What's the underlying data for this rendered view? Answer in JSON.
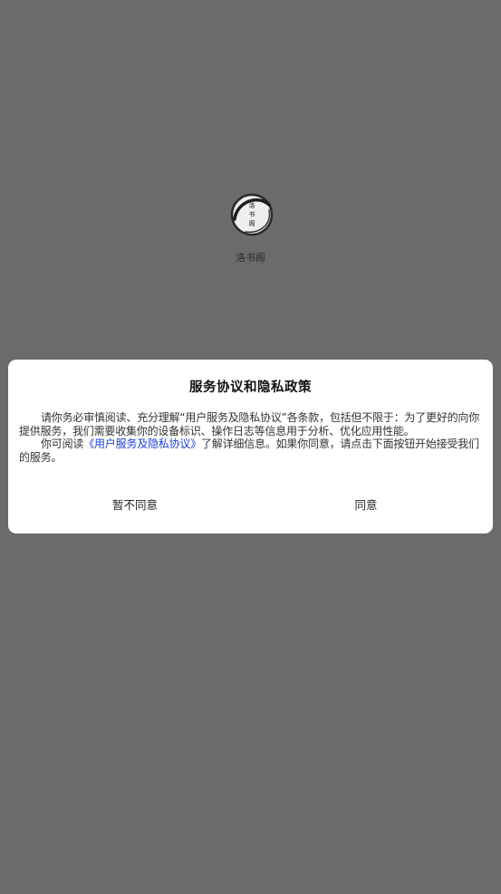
{
  "splash": {
    "logo_text": "洛书阁",
    "app_name": "洛书阁"
  },
  "dialog": {
    "title": "服务协议和隐私政策",
    "paragraph1": "请你务必审慎阅读、充分理解“用户服务及隐私协议”各条款，包括但不限于：为了更好的向你提供服务，我们需要收集你的设备标识、操作日志等信息用于分析、优化应用性能。",
    "paragraph2_prefix": "你可阅读",
    "paragraph2_link": "《用户服务及隐私协议》",
    "paragraph2_suffix": "了解详细信息。如果你同意，请点击下面按钮开始接受我们的服务。",
    "disagree_label": "暂不同意",
    "agree_label": "同意",
    "link_color": "#1a3fd6"
  },
  "colors": {
    "overlay_background": "#6b6b6b",
    "dialog_background": "#ffffff"
  }
}
